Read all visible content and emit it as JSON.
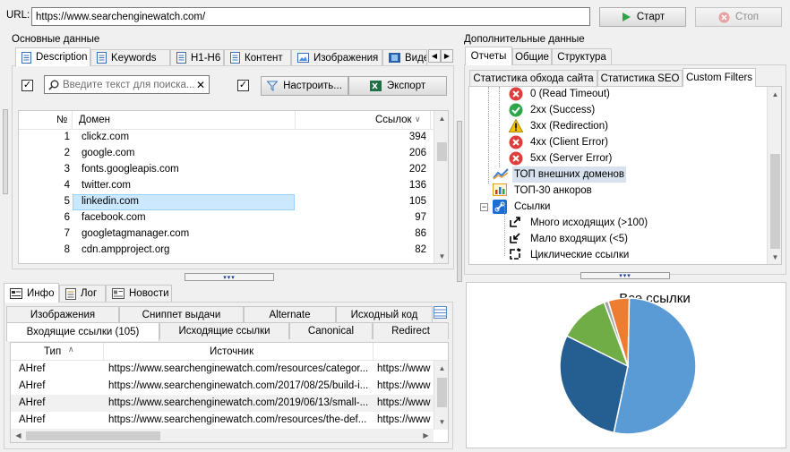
{
  "url_label": "URL:",
  "url_value": "https://www.searchenginewatch.com/",
  "start_label": "Старт",
  "stop_label": "Стоп",
  "main_data_label": "Основные данные",
  "extra_data_label": "Дополнительные данные",
  "main_tabs": [
    "Description",
    "Keywords",
    "H1-H6",
    "Контент",
    "Изображения",
    "Виде"
  ],
  "filter": {
    "placeholder": "Введите текст для поиска...",
    "configure_label": "Настроить...",
    "export_label": "Экспорт"
  },
  "domains_table": {
    "columns": [
      "№",
      "Домен",
      "Ссылок"
    ],
    "rows": [
      {
        "n": "1",
        "domain": "clickz.com",
        "links": "394"
      },
      {
        "n": "2",
        "domain": "google.com",
        "links": "206"
      },
      {
        "n": "3",
        "domain": "fonts.googleapis.com",
        "links": "202"
      },
      {
        "n": "4",
        "domain": "twitter.com",
        "links": "136"
      },
      {
        "n": "5",
        "domain": "linkedin.com",
        "links": "105"
      },
      {
        "n": "6",
        "domain": "facebook.com",
        "links": "97"
      },
      {
        "n": "7",
        "domain": "googletagmanager.com",
        "links": "86"
      },
      {
        "n": "8",
        "domain": "cdn.ampproject.org",
        "links": "82"
      }
    ]
  },
  "bottom_tabs": [
    "Инфо",
    "Лог",
    "Новости"
  ],
  "info_tabs_row1": [
    "Изображения",
    "Сниппет выдачи",
    "Alternate",
    "Исходный код"
  ],
  "info_tabs_row2": [
    "Входящие ссылки (105)",
    "Исходящие ссылки",
    "Canonical",
    "Redirect"
  ],
  "links_table": {
    "columns": [
      "Тип",
      "Источник"
    ],
    "rows": [
      {
        "type": "AHref",
        "source": "https://www.searchenginewatch.com/resources/categor...",
        "extra": "https://www"
      },
      {
        "type": "AHref",
        "source": "https://www.searchenginewatch.com/2017/08/25/build-i...",
        "extra": "https://www"
      },
      {
        "type": "AHref",
        "source": "https://www.searchenginewatch.com/2019/06/13/small-...",
        "extra": "https://www"
      },
      {
        "type": "AHref",
        "source": "https://www.searchenginewatch.com/resources/the-def...",
        "extra": "https://www"
      }
    ]
  },
  "right_tabs": [
    "Отчеты",
    "Общие",
    "Структура"
  ],
  "report_tabs": [
    "Статистика обхода сайта",
    "Статистика SEO",
    "Custom Filters"
  ],
  "tree": [
    {
      "label": "0 (Read Timeout)",
      "icon": "error-icon",
      "color": "#e03c3c"
    },
    {
      "label": "2xx (Success)",
      "icon": "success-icon",
      "color": "#2da64a"
    },
    {
      "label": "3xx (Redirection)",
      "icon": "warning-icon",
      "color": "#f2c200"
    },
    {
      "label": "4xx (Client Error)",
      "icon": "error-icon",
      "color": "#e03c3c"
    },
    {
      "label": "5xx (Server Error)",
      "icon": "error-icon",
      "color": "#e03c3c"
    },
    {
      "label": "ТОП внешних доменов",
      "icon": "chart-icon",
      "color": "#3c7dd2"
    },
    {
      "label": "ТОП-30 анкоров",
      "icon": "bar-chart-icon",
      "color": "#e6a01e"
    },
    {
      "label": "Ссылки",
      "icon": "link-icon",
      "color": "#1e6ed2"
    },
    {
      "label": "Много исходящих (>100)",
      "icon": "outgoing-icon",
      "color": "#000000"
    },
    {
      "label": "Мало входящих (<5)",
      "icon": "incoming-icon",
      "color": "#000000"
    },
    {
      "label": "Циклические ссылки",
      "icon": "cycle-icon",
      "color": "#000000"
    }
  ],
  "chart_data": {
    "type": "pie",
    "title": "Все ссылки",
    "slices": [
      {
        "value": 53,
        "color": "#5b9bd5"
      },
      {
        "value": 29,
        "color": "#255e91"
      },
      {
        "value": 12,
        "color": "#70ad47"
      },
      {
        "value": 1,
        "color": "#a5a5a5"
      },
      {
        "value": 5,
        "color": "#ed7d31"
      }
    ]
  }
}
